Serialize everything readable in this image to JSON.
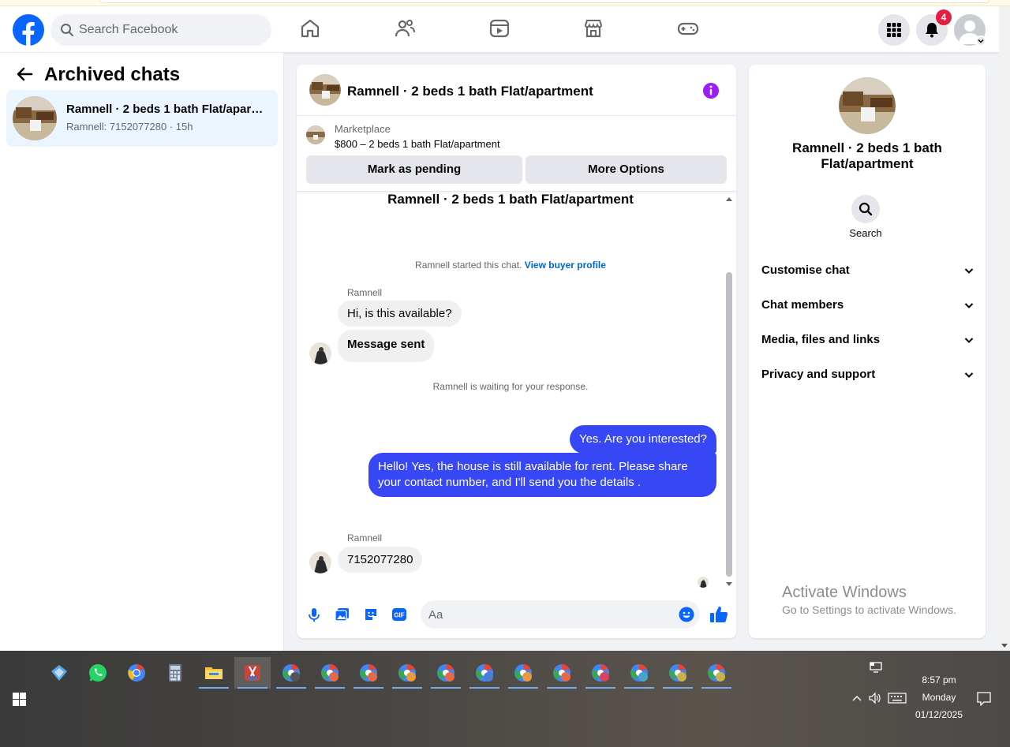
{
  "header": {
    "search_placeholder": "Search Facebook",
    "notification_count": "4",
    "brand_color": "#0866ff"
  },
  "sidebar": {
    "title": "Archived chats",
    "chats": [
      {
        "title": "Ramnell · 2 beds 1 bath Flat/apartment",
        "subtitle": "Ramnell: 7152077280 · 15h"
      }
    ]
  },
  "chat": {
    "title": "Ramnell · 2 beds 1 bath Flat/apartment",
    "marketplace_label": "Marketplace",
    "listing": "$800 – 2 beds 1 bath Flat/apartment",
    "mark_pending_label": "Mark as pending",
    "more_options_label": "More Options",
    "conversation_title": "Ramnell · 2 beds 1 bath Flat/apartment",
    "started_text": "Ramnell started this chat.",
    "view_profile_link": "View buyer profile",
    "waiting_text": "Ramnell is waiting for your response.",
    "messages": [
      {
        "sender": "Ramnell",
        "text": "Hi, is this available?"
      },
      {
        "sender": "",
        "text": "Message sent"
      },
      {
        "sender": "me",
        "text": "Yes. Are you interested?"
      },
      {
        "sender": "me",
        "text": "Hello! Yes, the house is still available for rent. Please share your contact number, and I'll send you the details ."
      },
      {
        "sender": "Ramnell",
        "text": "7152077280"
      }
    ],
    "sender_name": "Ramnell",
    "composer_placeholder": "Aa",
    "outgoing_color": "#3747f5"
  },
  "info_panel": {
    "name": "Ramnell · 2 beds 1 bath Flat/apartment",
    "search_label": "Search",
    "sections": [
      "Customise chat",
      "Chat members",
      "Media, files and links",
      "Privacy and support"
    ],
    "watermark_title": "Activate Windows",
    "watermark_sub": "Go to Settings to activate Windows."
  },
  "taskbar": {
    "time": "8:57 pm",
    "day": "Monday",
    "date": "01/12/2025",
    "apps": [
      "copilot-icon",
      "whatsapp-icon",
      "chrome-icon",
      "calculator-icon",
      "file-explorer-icon",
      "snipping-tool-icon",
      "chrome-profile-icon",
      "chrome-profile-icon",
      "chrome-profile-icon",
      "chrome-profile-icon",
      "chrome-profile-icon",
      "chrome-profile-icon",
      "chrome-profile-icon",
      "chrome-profile-icon",
      "chrome-profile-icon",
      "chrome-profile-icon",
      "chrome-profile-icon",
      "chrome-profile-icon"
    ]
  }
}
